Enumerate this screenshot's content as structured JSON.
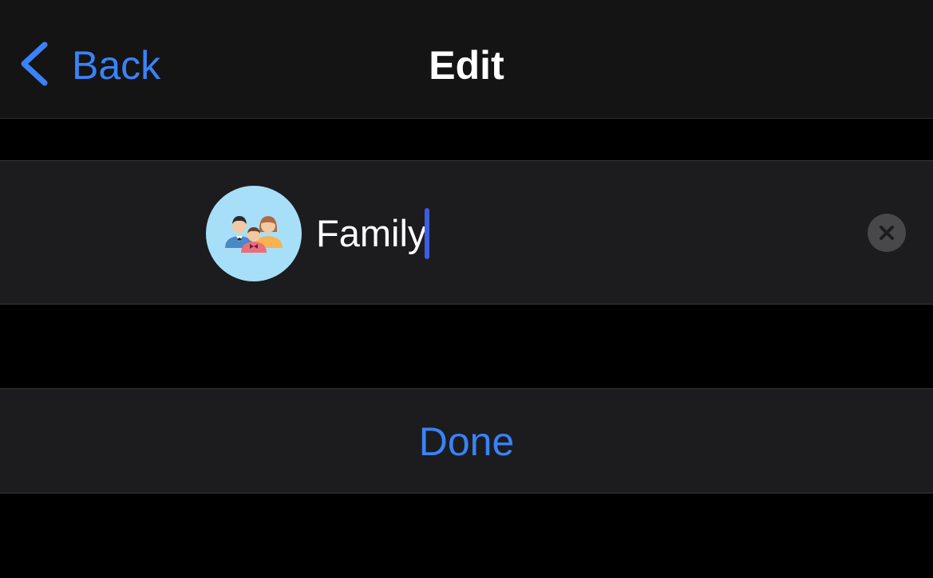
{
  "colors": {
    "accent": "#3a82f7",
    "text": "#ffffff",
    "caret": "#3d5ee0"
  },
  "navbar": {
    "back_label": "Back",
    "back_icon": "chevron-left-icon",
    "title": "Edit"
  },
  "group": {
    "name_value": "Family",
    "avatar_icon": "family-icon",
    "clear_icon": "close-icon"
  },
  "actions": {
    "done_label": "Done"
  }
}
